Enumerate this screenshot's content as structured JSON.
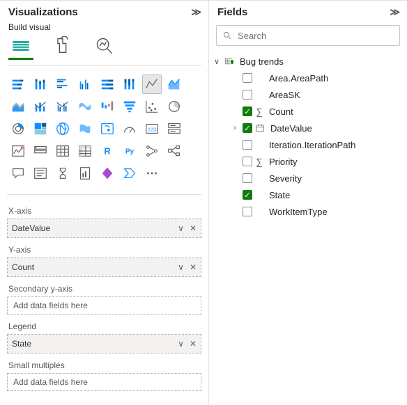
{
  "viz": {
    "title": "Visualizations",
    "subhead": "Build visual",
    "wells": {
      "xaxis": {
        "label": "X-axis",
        "value": "DateValue"
      },
      "yaxis": {
        "label": "Y-axis",
        "value": "Count"
      },
      "secy": {
        "label": "Secondary y-axis",
        "placeholder": "Add data fields here"
      },
      "legend": {
        "label": "Legend",
        "value": "State"
      },
      "small": {
        "label": "Small multiples",
        "placeholder": "Add data fields here"
      }
    }
  },
  "fields": {
    "title": "Fields",
    "search_placeholder": "Search",
    "table": "Bug trends",
    "items": [
      {
        "name": "Area.AreaPath",
        "checked": false,
        "sigma": false,
        "hier": false
      },
      {
        "name": "AreaSK",
        "checked": false,
        "sigma": false,
        "hier": false
      },
      {
        "name": "Count",
        "checked": true,
        "sigma": true,
        "hier": false
      },
      {
        "name": "DateValue",
        "checked": true,
        "sigma": false,
        "hier": true
      },
      {
        "name": "Iteration.IterationPath",
        "checked": false,
        "sigma": false,
        "hier": false
      },
      {
        "name": "Priority",
        "checked": false,
        "sigma": true,
        "hier": false
      },
      {
        "name": "Severity",
        "checked": false,
        "sigma": false,
        "hier": false
      },
      {
        "name": "State",
        "checked": true,
        "sigma": false,
        "hier": false
      },
      {
        "name": "WorkItemType",
        "checked": false,
        "sigma": false,
        "hier": false
      }
    ]
  }
}
